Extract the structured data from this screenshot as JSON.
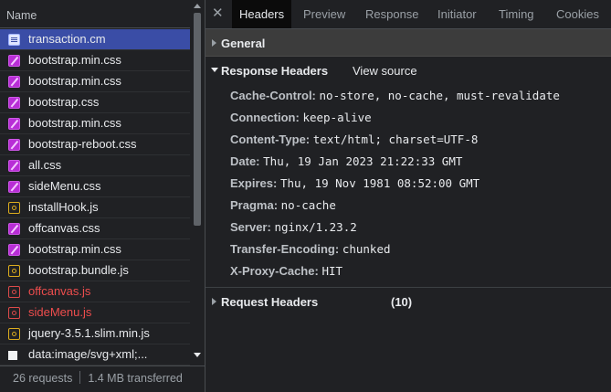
{
  "requests": {
    "column_header": "Name",
    "files": [
      {
        "name": "transaction.cm",
        "type": "document",
        "icon": "document-icon",
        "selected": true,
        "error": false
      },
      {
        "name": "bootstrap.min.css",
        "type": "stylesheet",
        "icon": "css-file-icon",
        "selected": false,
        "error": false
      },
      {
        "name": "bootstrap.min.css",
        "type": "stylesheet",
        "icon": "css-file-icon",
        "selected": false,
        "error": false
      },
      {
        "name": "bootstrap.css",
        "type": "stylesheet",
        "icon": "css-file-icon",
        "selected": false,
        "error": false
      },
      {
        "name": "bootstrap.min.css",
        "type": "stylesheet",
        "icon": "css-file-icon",
        "selected": false,
        "error": false
      },
      {
        "name": "bootstrap-reboot.css",
        "type": "stylesheet",
        "icon": "css-file-icon",
        "selected": false,
        "error": false
      },
      {
        "name": "all.css",
        "type": "stylesheet",
        "icon": "css-file-icon",
        "selected": false,
        "error": false
      },
      {
        "name": "sideMenu.css",
        "type": "stylesheet",
        "icon": "css-file-icon",
        "selected": false,
        "error": false
      },
      {
        "name": "installHook.js",
        "type": "script",
        "icon": "js-file-icon",
        "selected": false,
        "error": false
      },
      {
        "name": "offcanvas.css",
        "type": "stylesheet",
        "icon": "css-file-icon",
        "selected": false,
        "error": false
      },
      {
        "name": "bootstrap.min.css",
        "type": "stylesheet",
        "icon": "css-file-icon",
        "selected": false,
        "error": false
      },
      {
        "name": "bootstrap.bundle.js",
        "type": "script",
        "icon": "js-file-icon",
        "selected": false,
        "error": false
      },
      {
        "name": "offcanvas.js",
        "type": "script",
        "icon": "js-file-icon",
        "selected": false,
        "error": true
      },
      {
        "name": "sideMenu.js",
        "type": "script",
        "icon": "js-file-icon",
        "selected": false,
        "error": true
      },
      {
        "name": "jquery-3.5.1.slim.min.js",
        "type": "script",
        "icon": "js-file-icon",
        "selected": false,
        "error": false
      },
      {
        "name": "data:image/svg+xml;...",
        "type": "image",
        "icon": "image-file-icon",
        "selected": false,
        "error": false
      }
    ],
    "status": {
      "requests_count": "26 requests",
      "transferred": "1.4 MB transferred"
    }
  },
  "details": {
    "close_icon": "close-icon",
    "tabs": [
      {
        "label": "Headers",
        "active": true
      },
      {
        "label": "Preview",
        "active": false
      },
      {
        "label": "Response",
        "active": false
      },
      {
        "label": "Initiator",
        "active": false
      },
      {
        "label": "Timing",
        "active": false
      },
      {
        "label": "Cookies",
        "active": false
      }
    ],
    "general": {
      "title": "General",
      "expanded": false
    },
    "response_headers": {
      "title": "Response Headers",
      "view_source": "View source",
      "expanded": true,
      "headers": [
        {
          "key": "Cache-Control:",
          "value": "no-store, no-cache, must-revalidate"
        },
        {
          "key": "Connection:",
          "value": "keep-alive"
        },
        {
          "key": "Content-Type:",
          "value": "text/html; charset=UTF-8"
        },
        {
          "key": "Date:",
          "value": "Thu, 19 Jan 2023 21:22:33 GMT"
        },
        {
          "key": "Expires:",
          "value": "Thu, 19 Nov 1981 08:52:00 GMT"
        },
        {
          "key": "Pragma:",
          "value": "no-cache"
        },
        {
          "key": "Server:",
          "value": "nginx/1.23.2"
        },
        {
          "key": "Transfer-Encoding:",
          "value": "chunked"
        },
        {
          "key": "X-Proxy-Cache:",
          "value": "HIT"
        }
      ]
    },
    "request_headers": {
      "title": "Request Headers",
      "count": "(10)",
      "expanded": false
    }
  },
  "colors": {
    "background": "#202124",
    "selected_row": "#3a4da6",
    "error_text": "#ee4d4d",
    "active_tab": "#0b0b0b",
    "section_header": "#3c3c3c"
  }
}
